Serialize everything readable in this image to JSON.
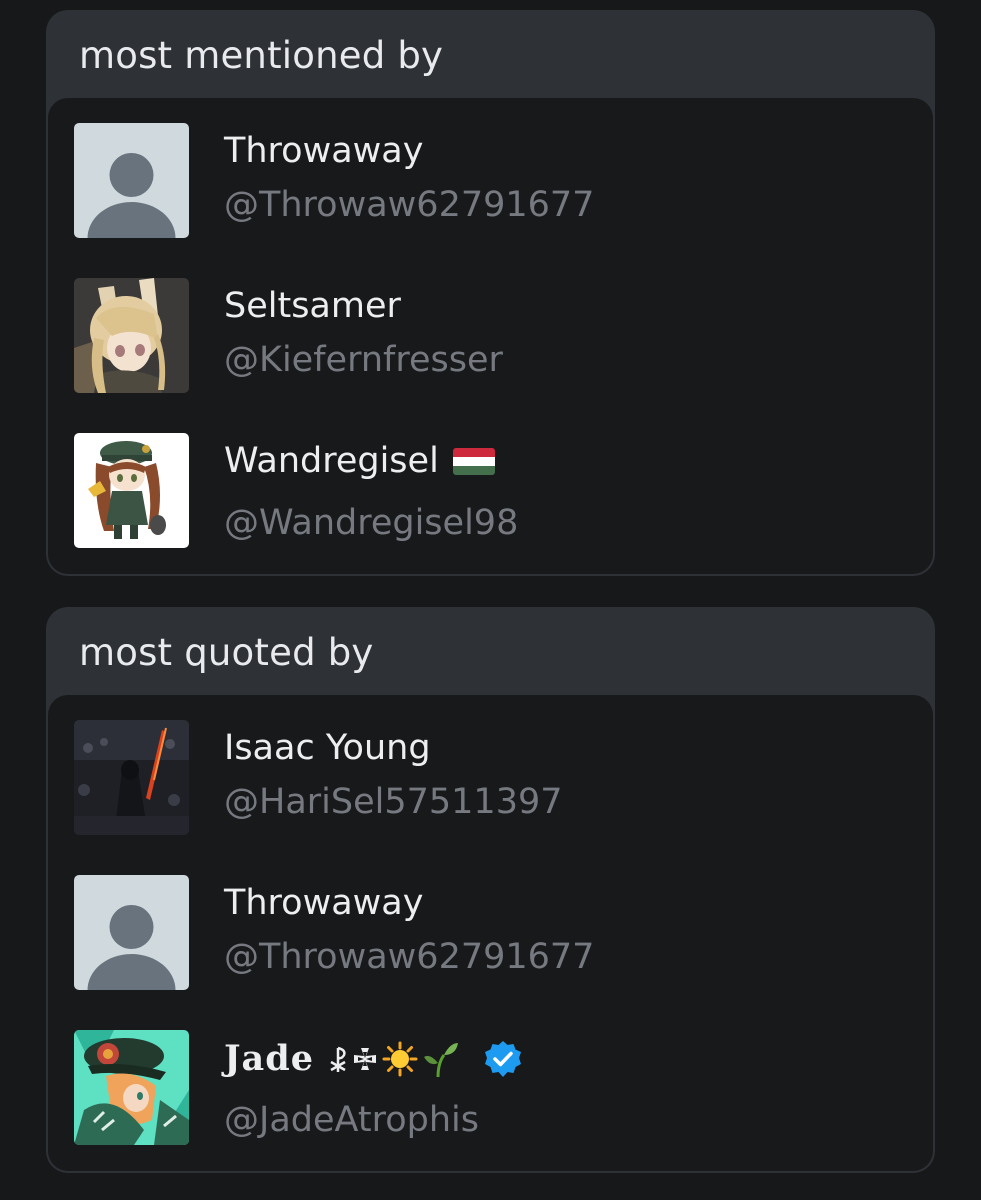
{
  "mentioned": {
    "title": "most mentioned by",
    "users": [
      {
        "name": "Throwaway",
        "handle": "@Throwaw62791677",
        "avatar": "default-avatar"
      },
      {
        "name": "Seltsamer",
        "handle": "@Kiefernfresser",
        "avatar": "anime-fox-girl-avatar"
      },
      {
        "name": "Wandregisel",
        "handle": "@Wandregisel98",
        "avatar": "anime-soldier-girl-avatar",
        "flag": "hungary-flag"
      }
    ]
  },
  "quoted": {
    "title": "most quoted by",
    "users": [
      {
        "name": "Isaac Young",
        "handle": "@HariSel57511397",
        "avatar": "dark-knight-avatar"
      },
      {
        "name": "Throwaway",
        "handle": "@Throwaw62791677",
        "avatar": "default-avatar"
      },
      {
        "name": "Jade",
        "handle": "@JadeAtrophis",
        "avatar": "anime-officer-avatar",
        "verified": true,
        "name_symbols": [
          "chi-rho-icon",
          "iron-cross-icon",
          "sun-icon",
          "seedling-icon"
        ]
      }
    ]
  },
  "colors": {
    "background": "#16181a",
    "section_header": "#2e3135",
    "panel": "#17191b",
    "text_primary": "#eceef0",
    "text_secondary": "#767a80",
    "verified_blue": "#1d9bf0"
  }
}
